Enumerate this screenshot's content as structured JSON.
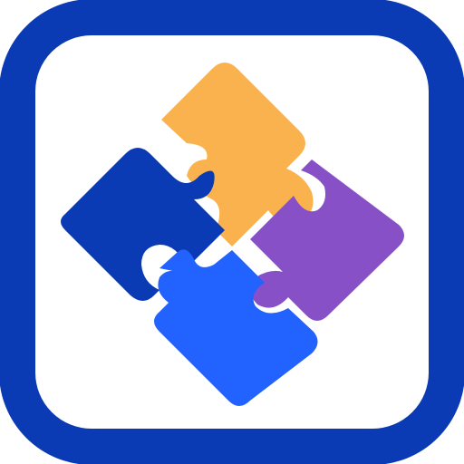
{
  "icon": {
    "name": "puzzle-app-icon",
    "frame_color": "#0A3BB4",
    "background_color": "#FFFFFF",
    "pieces": [
      {
        "name": "puzzle-piece-top",
        "color": "#F9B24D"
      },
      {
        "name": "puzzle-piece-left",
        "color": "#0A3BB4"
      },
      {
        "name": "puzzle-piece-right",
        "color": "#8750C6"
      },
      {
        "name": "puzzle-piece-bottom",
        "color": "#2263FF"
      }
    ]
  }
}
